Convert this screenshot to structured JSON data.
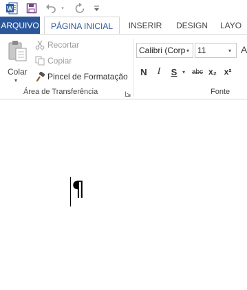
{
  "qat": {
    "word_icon": "word-app-icon",
    "save_icon": "save-icon",
    "undo_icon": "undo-icon",
    "redo_icon": "redo-icon",
    "customize_icon": "customize-qat-icon"
  },
  "tabs": {
    "file": "ARQUIVO",
    "home": "PÁGINA INICIAL",
    "insert": "INSERIR",
    "design": "DESIGN",
    "layout": "LAYO"
  },
  "clipboard": {
    "paste_label": "Colar",
    "cut_label": "Recortar",
    "copy_label": "Copiar",
    "format_painter_label": "Pincel de Formatação",
    "group_label": "Área de Transferência"
  },
  "font": {
    "font_name": "Calibri (Corp",
    "font_size": "11",
    "grow_font": "A",
    "bold": "N",
    "italic": "I",
    "underline": "S",
    "strikethrough": "abc",
    "subscript": "x₂",
    "superscript": "x²",
    "group_label": "Fonte"
  },
  "document": {
    "paragraph_mark": "¶"
  }
}
